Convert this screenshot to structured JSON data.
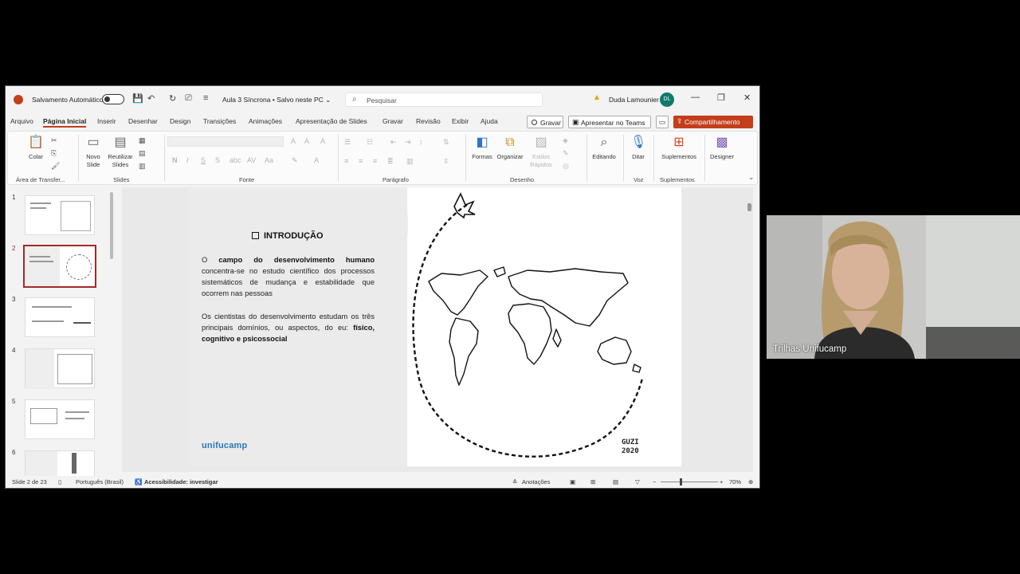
{
  "window": {
    "autosave_label": "Salvamento Automático",
    "doc_title": "Aula 3 Síncrona • Salvo neste PC ⌄",
    "search_placeholder": "Pesquisar",
    "user_name": "Duda Lamounier",
    "user_initials": "DL"
  },
  "menu": {
    "items": [
      "Arquivo",
      "Página Inicial",
      "Inserir",
      "Desenhar",
      "Design",
      "Transições",
      "Animações",
      "Apresentação de Slides",
      "Gravar",
      "Revisão",
      "Exibir",
      "Ajuda"
    ],
    "gravar_button": "Gravar",
    "teams_button": "Apresentar no Teams",
    "share_button": "Compartilhamento"
  },
  "ribbon": {
    "colar": "Colar",
    "novo_slide": "Novo Slide",
    "reutilizar_slides": "Reutilizar Slides",
    "formas": "Formas",
    "organizar": "Organizar",
    "estilos_rapidos": "Estilos Rápidos",
    "editando": "Editando",
    "ditar": "Ditar",
    "suplementos": "Suplementos",
    "designer": "Designer",
    "groups": {
      "clipboard": "Área de Transfer...",
      "slides": "Slides",
      "fonte": "Fonte",
      "paragrafo": "Parágrafo",
      "desenho": "Desenho",
      "voz": "Voz",
      "suplementos": "Suplementos"
    }
  },
  "thumbnails": [
    "1",
    "2",
    "3",
    "4",
    "5",
    "6"
  ],
  "slide": {
    "heading": "INTRODUÇÃO",
    "p1_pre": "O ",
    "p1_bold": "campo do desenvolvimento humano",
    "p1_rest": " concentra-se no estudo científico dos processos sistemáticos de mudança e estabilidade que ocorrem nas pessoas",
    "p2": "Os cientistas do desenvolvimento estudam os três principais domínios, ou aspectos, do eu:",
    "p2_bold": "físico, cognitivo e psicossocial",
    "brand": "unifucamp",
    "signature_line1": "GUZI",
    "signature_line2": "2020"
  },
  "status": {
    "slide_counter": "Slide 2 de 23",
    "language": "Português (Brasil)",
    "accessibility": "Acessibilidade: investigar",
    "notes": "Anotações",
    "zoom": "70%"
  },
  "camera": {
    "label": "Trilhas Unifucamp"
  }
}
